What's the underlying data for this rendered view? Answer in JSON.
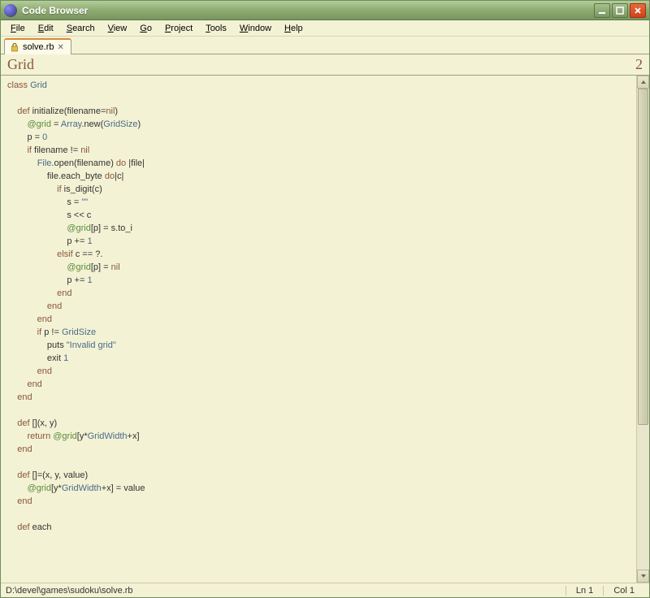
{
  "window": {
    "title": "Code Browser"
  },
  "menu": {
    "file": "File",
    "edit": "Edit",
    "search": "Search",
    "view": "View",
    "go": "Go",
    "project": "Project",
    "tools": "Tools",
    "window": "Window",
    "help": "Help"
  },
  "tab": {
    "label": "solve.rb"
  },
  "section": {
    "title": "Grid",
    "right": "2"
  },
  "status": {
    "path": "D:\\devel\\games\\sudoku\\solve.rb",
    "line": "Ln 1",
    "col": "Col 1"
  },
  "code": {
    "l01a": "class",
    "l01b": " Grid",
    "l03a": "    def",
    "l03b": " initialize(filename=",
    "l03c": "nil",
    "l03d": ")",
    "l04a": "        ",
    "l04b": "@grid",
    "l04c": " = ",
    "l04d": "Array",
    "l04e": ".new(",
    "l04f": "GridSize",
    "l04g": ")",
    "l05a": "        p = ",
    "l05b": "0",
    "l06a": "        if",
    "l06b": " filename != ",
    "l06c": "nil",
    "l07a": "            ",
    "l07b": "File",
    "l07c": ".open(filename) ",
    "l07d": "do",
    "l07e": " |file|",
    "l08a": "                file.each_byte ",
    "l08b": "do",
    "l08c": "|c|",
    "l09a": "                    if",
    "l09b": " is_digit(c)",
    "l10a": "                        s = ",
    "l10b": "\"\"",
    "l11a": "                        s << c",
    "l12a": "                        ",
    "l12b": "@grid",
    "l12c": "[p] = s.to_i",
    "l13a": "                        p += ",
    "l13b": "1",
    "l14a": "                    elsif",
    "l14b": " c == ?.",
    "l15a": "                        ",
    "l15b": "@grid",
    "l15c": "[p] = ",
    "l15d": "nil",
    "l16a": "                        p += ",
    "l16b": "1",
    "l17a": "                    end",
    "l18a": "                end",
    "l19a": "            end",
    "l20a": "            if",
    "l20b": " p != ",
    "l20c": "GridSize",
    "l21a": "                puts ",
    "l21b": "\"Invalid grid\"",
    "l22a": "                exit ",
    "l22b": "1",
    "l23a": "            end",
    "l24a": "        end",
    "l25a": "    end",
    "l27a": "    def",
    "l27b": " [](x, y)",
    "l28a": "        return ",
    "l28b": "@grid",
    "l28c": "[y*",
    "l28d": "GridWidth",
    "l28e": "+x]",
    "l29a": "    end",
    "l31a": "    def",
    "l31b": " []=(x, y, value)",
    "l32a": "        ",
    "l32b": "@grid",
    "l32c": "[y*",
    "l32d": "GridWidth",
    "l32e": "+x] = value",
    "l33a": "    end",
    "l35a": "    def",
    "l35b": " each"
  }
}
